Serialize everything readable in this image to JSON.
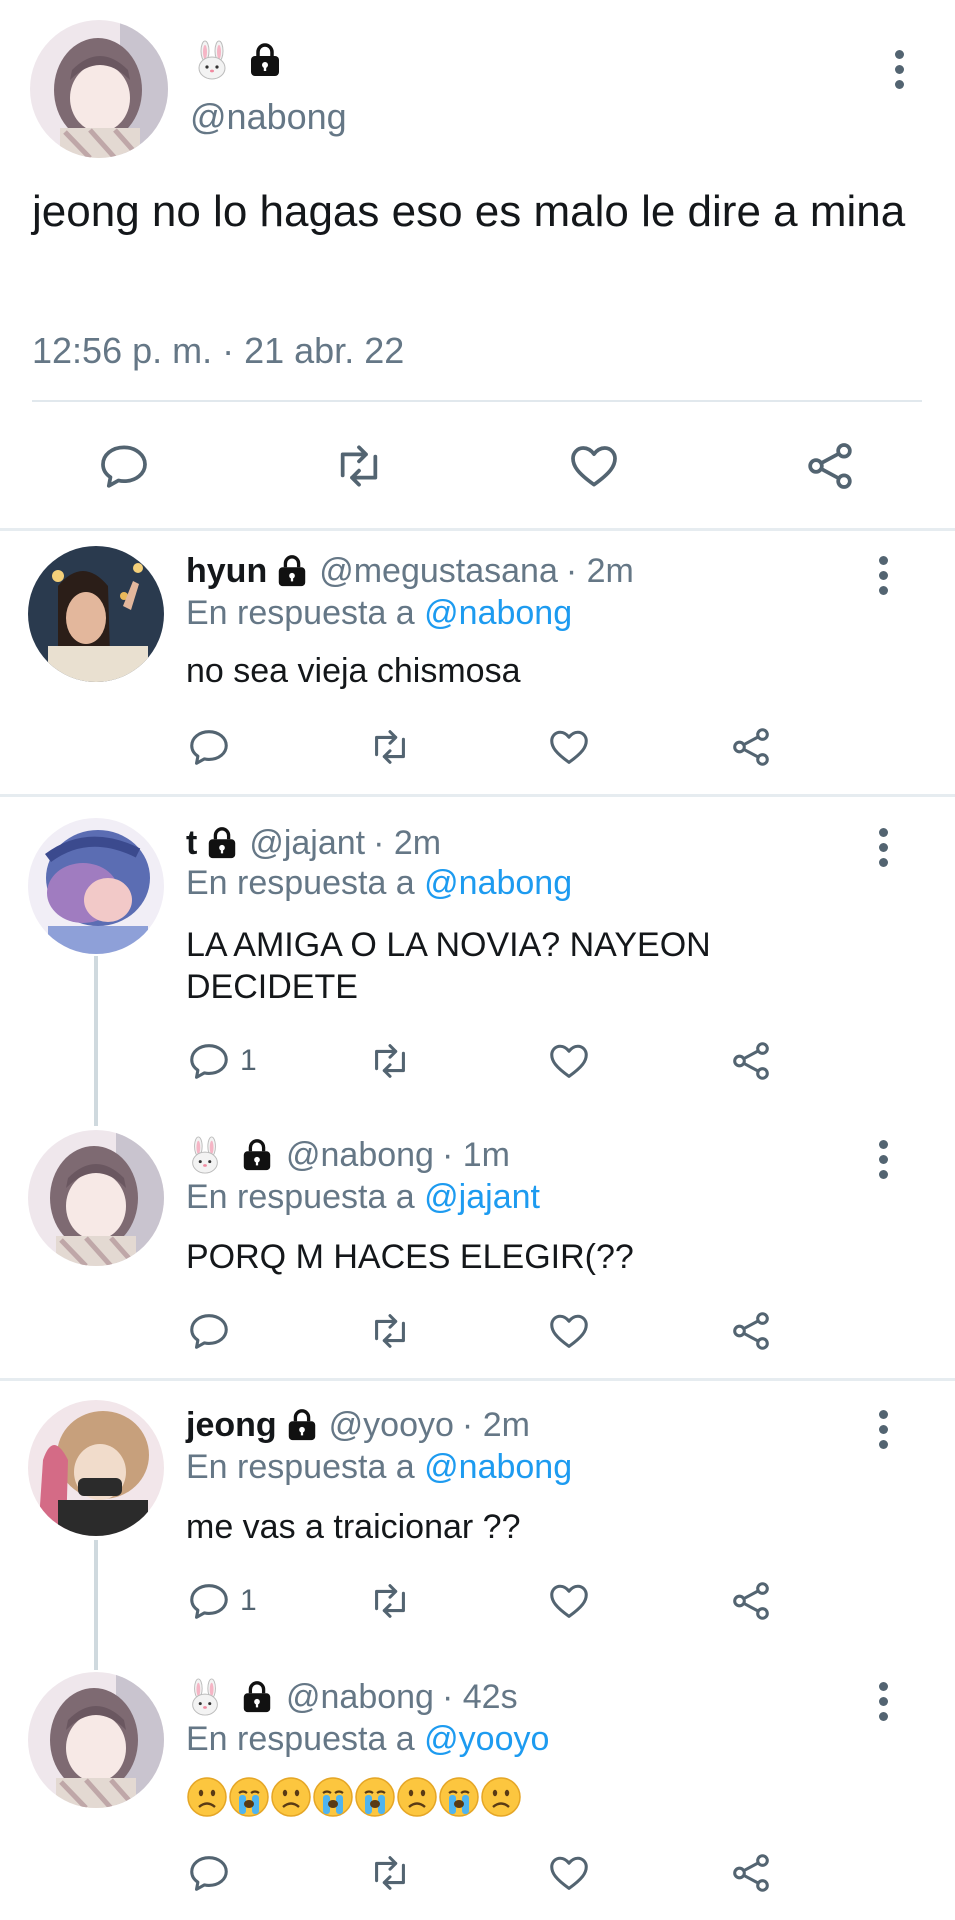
{
  "main": {
    "emoji": "🐰",
    "handle": "@nabong",
    "text": "jeong no lo hagas eso es malo le dire a mina",
    "timestamp": "12:56 p. m. · 21 abr. 22"
  },
  "replies": [
    {
      "name": "hyun",
      "handle": "@megustasana",
      "time": "· 2m",
      "reply_prefix": "En respuesta a",
      "reply_to": "@nabong",
      "text": "no sea vieja chismosa",
      "reply_count": ""
    },
    {
      "name": "t",
      "handle": "@jajant",
      "time": "· 2m",
      "reply_prefix": "En respuesta a",
      "reply_to": "@nabong",
      "text_lines": [
        "LA AMIGA O LA NOVIA? NAYEON",
        "DECIDETE"
      ],
      "reply_count": "1"
    },
    {
      "name": "🐰",
      "handle": "@nabong",
      "time": "· 1m",
      "reply_prefix": "En respuesta a",
      "reply_to": "@jajant",
      "text": "PORQ M HACES ELEGIR(??",
      "reply_count": ""
    },
    {
      "name": "jeong",
      "handle": "@yooyo",
      "time": "· 2m",
      "reply_prefix": "En respuesta a",
      "reply_to": "@nabong",
      "text": "me vas a traicionar ??",
      "reply_count": "1"
    },
    {
      "name": "🐰",
      "handle": "@nabong",
      "time": "· 42s",
      "reply_prefix": "En respuesta a",
      "reply_to": "@yooyo",
      "emoji_sequence": [
        "frowning",
        "crying",
        "frowning",
        "crying",
        "crying",
        "frowning",
        "crying",
        "frowning"
      ],
      "reply_count": ""
    }
  ],
  "icons": [
    "avatar",
    "lock-icon",
    "more-options-icon",
    "reply-icon",
    "retweet-icon",
    "like-icon",
    "share-icon"
  ],
  "colors": {
    "link": "#1d9bf0",
    "muted": "#536471",
    "separator": "#e6ecf0",
    "text": "#14171a"
  }
}
